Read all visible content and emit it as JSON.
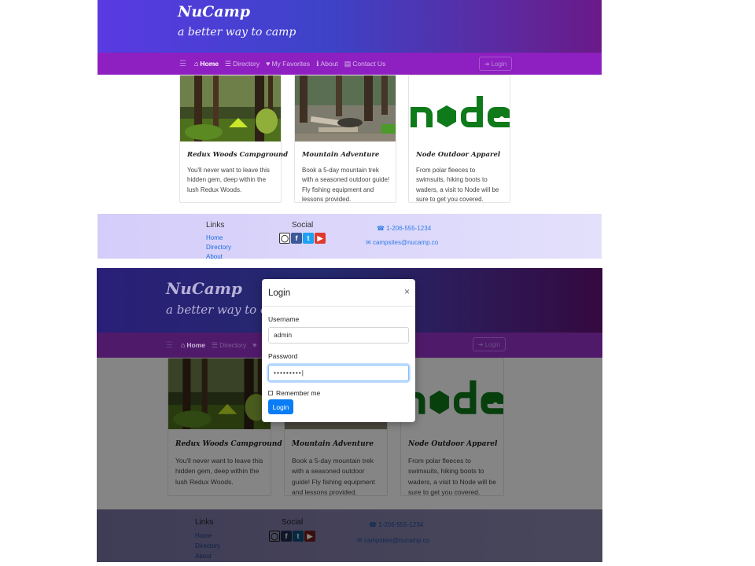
{
  "brand": {
    "title": "NuCamp",
    "subtitle": "a better way to camp"
  },
  "nav": {
    "items": [
      {
        "label": "Home",
        "icon": "home-icon",
        "active": true
      },
      {
        "label": "Directory",
        "icon": "list-icon",
        "active": false
      },
      {
        "label": "My Favorites",
        "icon": "heart-icon",
        "active": false
      },
      {
        "label": "About",
        "icon": "info-icon",
        "active": false
      },
      {
        "label": "Contact Us",
        "icon": "address-card-icon",
        "active": false
      }
    ],
    "login_label": "Login",
    "login_icon": "sign-in-icon"
  },
  "cards": [
    {
      "title": "Redux Woods Campground",
      "text": "You'll never want to leave this hidden gem, deep within the lush Redux Woods."
    },
    {
      "title": "Mountain Adventure",
      "text": "Book a 5-day mountain trek with a seasoned outdoor guide! Fly fishing equipment and lessons provided."
    },
    {
      "title": "Node Outdoor Apparel",
      "text": "From polar fleeces to swimsuits, hiking boots to waders, a visit to Node will be sure to get you covered."
    }
  ],
  "footer": {
    "links_heading": "Links",
    "links": [
      "Home",
      "Directory",
      "About"
    ],
    "social_heading": "Social",
    "social": [
      "instagram-icon",
      "facebook-icon",
      "twitter-icon",
      "youtube-icon"
    ],
    "phone": "1-206-555-1234",
    "email": "campsites@nucamp.co"
  },
  "modal": {
    "title": "Login",
    "close": "×",
    "username_label": "Username",
    "username_value": "admin",
    "password_label": "Password",
    "password_value": "•••••••••|",
    "remember_label": "Remember me",
    "submit_label": "Login"
  },
  "colors": {
    "jumbotron_start": "#5a3ae2",
    "jumbotron_end": "#6a1a88",
    "navbar": "#8e1fc0",
    "footer": "#d4cdfa",
    "primary_button": "#0a7cf5",
    "node_green": "#0f7a1a"
  }
}
